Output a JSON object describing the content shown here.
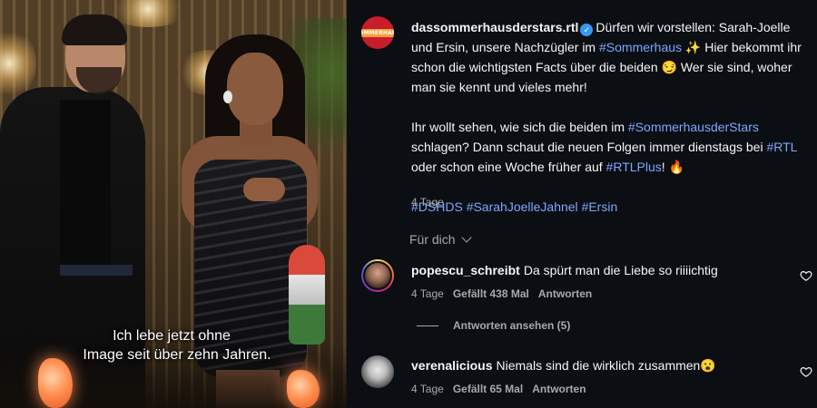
{
  "media": {
    "subtitle_line1": "Ich lebe jetzt ohne",
    "subtitle_line2": "Image seit über zehn Jahren."
  },
  "caption": {
    "username": "dassommerhausderstars.rtl",
    "avatar_logo_text": "SOMMERHAUS",
    "p1_a": "Dürfen wir vorstellen: Sarah-Joelle und Ersin, unsere Nachzügler im ",
    "p1_tag": "#Sommerhaus",
    "p1_b": " ✨ Hier bekommt ihr schon die wichtigsten Facts über die beiden 😏 Wer sie sind, woher man sie kennt und vieles mehr!",
    "p2_a": "Ihr wollt sehen, wie sich die beiden im ",
    "p2_tag1": "#SommerhausderStars",
    "p2_b": " schlagen? Dann schaut die neuen Folgen immer dienstags bei ",
    "p2_tag2": "#RTL",
    "p2_c": " oder schon eine Woche früher auf ",
    "p2_tag3": "#RTLPlus",
    "p2_d": "! 🔥",
    "hashtags": [
      "#DSHDS",
      "#SarahJoelleJahnel",
      "#Ersin"
    ],
    "age": "4 Tage"
  },
  "filter": {
    "label": "Für dich"
  },
  "comments": [
    {
      "username": "popescu_schreibt",
      "text": "Da spürt man die Liebe so riiiichtig",
      "age": "4 Tage",
      "likes": "Gefällt 438 Mal",
      "reply": "Antworten",
      "view_replies": "Antworten ansehen (5)"
    },
    {
      "username": "verenalicious",
      "text": "Niemals sind die wirklich zusammen😮",
      "age": "4 Tage",
      "likes": "Gefällt 65 Mal",
      "reply": "Antworten"
    }
  ],
  "colors": {
    "panel_bg": "#0b0e13",
    "hashtag": "#7fa6ff",
    "verified": "#3797f0",
    "muted": "#a8a8a8"
  }
}
